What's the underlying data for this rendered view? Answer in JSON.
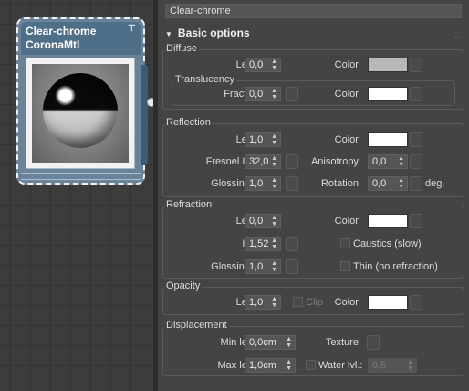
{
  "node": {
    "title": "Clear-chrome",
    "subtitle": "CoronaMtl"
  },
  "material_name": "Clear-chrome",
  "rollout": {
    "title": "Basic options"
  },
  "diffuse": {
    "title": "Diffuse",
    "level_label": "Level:",
    "level": "0,0",
    "color_label": "Color:",
    "color": "#b8b8b8",
    "translucency_title": "Translucency",
    "fraction_label": "Fraction:",
    "fraction": "0,0",
    "trans_color_label": "Color:",
    "trans_color": "#ffffff"
  },
  "reflection": {
    "title": "Reflection",
    "level_label": "Level:",
    "level": "1,0",
    "color_label": "Color:",
    "color": "#ffffff",
    "fresnel_label": "Fresnel IOR:",
    "fresnel": "32,0",
    "anisotropy_label": "Anisotropy:",
    "anisotropy": "0,0",
    "glossiness_label": "Glossiness:",
    "glossiness": "1,0",
    "rotation_label": "Rotation:",
    "rotation": "0,0",
    "deg_label": "deg."
  },
  "refraction": {
    "title": "Refraction",
    "level_label": "Level:",
    "level": "0,0",
    "color_label": "Color:",
    "color": "#ffffff",
    "ior_label": "IOR:",
    "ior": "1,52",
    "caustics_label": "Caustics (slow)",
    "glossiness_label": "Glossiness:",
    "glossiness": "1,0",
    "thin_label": "Thin (no refraction)"
  },
  "opacity": {
    "title": "Opacity",
    "level_label": "Level:",
    "level": "1,0",
    "clip_label": "Clip",
    "color_label": "Color:",
    "color": "#ffffff"
  },
  "displacement": {
    "title": "Displacement",
    "min_label": "Min level:",
    "min": "0,0cm",
    "texture_label": "Texture:",
    "max_label": "Max level:",
    "max": "1,0cm",
    "water_label": "Water lvl.:",
    "water": "0,5"
  },
  "icons": {
    "spinner": "up-down-arrows-icon",
    "map": "map-slot-icon",
    "rollout": "triangle-down-icon",
    "grip": "drag-grip-icon",
    "pin": "pin-icon"
  }
}
